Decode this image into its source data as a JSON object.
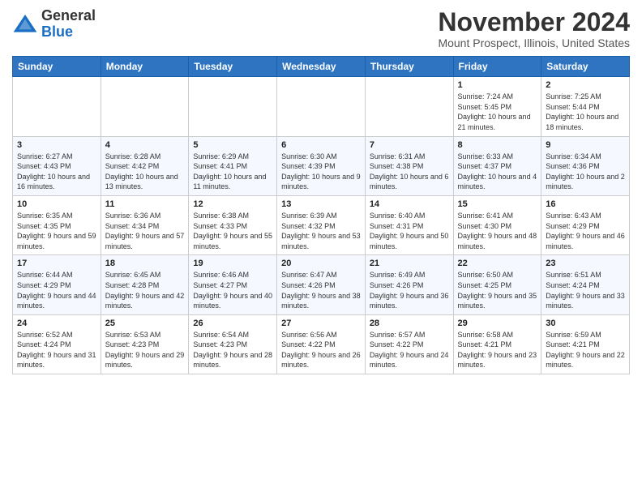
{
  "header": {
    "logo_line1": "General",
    "logo_line2": "Blue",
    "month_title": "November 2024",
    "location": "Mount Prospect, Illinois, United States"
  },
  "days_of_week": [
    "Sunday",
    "Monday",
    "Tuesday",
    "Wednesday",
    "Thursday",
    "Friday",
    "Saturday"
  ],
  "weeks": [
    [
      {
        "day": "",
        "info": ""
      },
      {
        "day": "",
        "info": ""
      },
      {
        "day": "",
        "info": ""
      },
      {
        "day": "",
        "info": ""
      },
      {
        "day": "",
        "info": ""
      },
      {
        "day": "1",
        "info": "Sunrise: 7:24 AM\nSunset: 5:45 PM\nDaylight: 10 hours and 21 minutes."
      },
      {
        "day": "2",
        "info": "Sunrise: 7:25 AM\nSunset: 5:44 PM\nDaylight: 10 hours and 18 minutes."
      }
    ],
    [
      {
        "day": "3",
        "info": "Sunrise: 6:27 AM\nSunset: 4:43 PM\nDaylight: 10 hours and 16 minutes."
      },
      {
        "day": "4",
        "info": "Sunrise: 6:28 AM\nSunset: 4:42 PM\nDaylight: 10 hours and 13 minutes."
      },
      {
        "day": "5",
        "info": "Sunrise: 6:29 AM\nSunset: 4:41 PM\nDaylight: 10 hours and 11 minutes."
      },
      {
        "day": "6",
        "info": "Sunrise: 6:30 AM\nSunset: 4:39 PM\nDaylight: 10 hours and 9 minutes."
      },
      {
        "day": "7",
        "info": "Sunrise: 6:31 AM\nSunset: 4:38 PM\nDaylight: 10 hours and 6 minutes."
      },
      {
        "day": "8",
        "info": "Sunrise: 6:33 AM\nSunset: 4:37 PM\nDaylight: 10 hours and 4 minutes."
      },
      {
        "day": "9",
        "info": "Sunrise: 6:34 AM\nSunset: 4:36 PM\nDaylight: 10 hours and 2 minutes."
      }
    ],
    [
      {
        "day": "10",
        "info": "Sunrise: 6:35 AM\nSunset: 4:35 PM\nDaylight: 9 hours and 59 minutes."
      },
      {
        "day": "11",
        "info": "Sunrise: 6:36 AM\nSunset: 4:34 PM\nDaylight: 9 hours and 57 minutes."
      },
      {
        "day": "12",
        "info": "Sunrise: 6:38 AM\nSunset: 4:33 PM\nDaylight: 9 hours and 55 minutes."
      },
      {
        "day": "13",
        "info": "Sunrise: 6:39 AM\nSunset: 4:32 PM\nDaylight: 9 hours and 53 minutes."
      },
      {
        "day": "14",
        "info": "Sunrise: 6:40 AM\nSunset: 4:31 PM\nDaylight: 9 hours and 50 minutes."
      },
      {
        "day": "15",
        "info": "Sunrise: 6:41 AM\nSunset: 4:30 PM\nDaylight: 9 hours and 48 minutes."
      },
      {
        "day": "16",
        "info": "Sunrise: 6:43 AM\nSunset: 4:29 PM\nDaylight: 9 hours and 46 minutes."
      }
    ],
    [
      {
        "day": "17",
        "info": "Sunrise: 6:44 AM\nSunset: 4:29 PM\nDaylight: 9 hours and 44 minutes."
      },
      {
        "day": "18",
        "info": "Sunrise: 6:45 AM\nSunset: 4:28 PM\nDaylight: 9 hours and 42 minutes."
      },
      {
        "day": "19",
        "info": "Sunrise: 6:46 AM\nSunset: 4:27 PM\nDaylight: 9 hours and 40 minutes."
      },
      {
        "day": "20",
        "info": "Sunrise: 6:47 AM\nSunset: 4:26 PM\nDaylight: 9 hours and 38 minutes."
      },
      {
        "day": "21",
        "info": "Sunrise: 6:49 AM\nSunset: 4:26 PM\nDaylight: 9 hours and 36 minutes."
      },
      {
        "day": "22",
        "info": "Sunrise: 6:50 AM\nSunset: 4:25 PM\nDaylight: 9 hours and 35 minutes."
      },
      {
        "day": "23",
        "info": "Sunrise: 6:51 AM\nSunset: 4:24 PM\nDaylight: 9 hours and 33 minutes."
      }
    ],
    [
      {
        "day": "24",
        "info": "Sunrise: 6:52 AM\nSunset: 4:24 PM\nDaylight: 9 hours and 31 minutes."
      },
      {
        "day": "25",
        "info": "Sunrise: 6:53 AM\nSunset: 4:23 PM\nDaylight: 9 hours and 29 minutes."
      },
      {
        "day": "26",
        "info": "Sunrise: 6:54 AM\nSunset: 4:23 PM\nDaylight: 9 hours and 28 minutes."
      },
      {
        "day": "27",
        "info": "Sunrise: 6:56 AM\nSunset: 4:22 PM\nDaylight: 9 hours and 26 minutes."
      },
      {
        "day": "28",
        "info": "Sunrise: 6:57 AM\nSunset: 4:22 PM\nDaylight: 9 hours and 24 minutes."
      },
      {
        "day": "29",
        "info": "Sunrise: 6:58 AM\nSunset: 4:21 PM\nDaylight: 9 hours and 23 minutes."
      },
      {
        "day": "30",
        "info": "Sunrise: 6:59 AM\nSunset: 4:21 PM\nDaylight: 9 hours and 22 minutes."
      }
    ]
  ]
}
